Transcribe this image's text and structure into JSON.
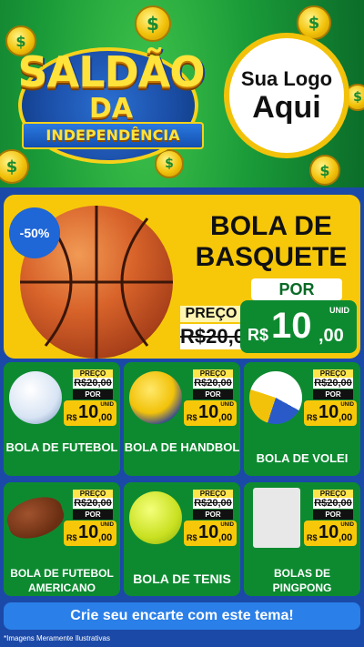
{
  "header": {
    "title_line1": "SALDÃO",
    "title_line2": "DA",
    "title_line3": "INDEPENDÊNCIA",
    "logo_line1": "Sua Logo",
    "logo_line2": "Aqui"
  },
  "colors": {
    "green": "#0d8a30",
    "yellow": "#f7c80a",
    "blue": "#1b49a8"
  },
  "feature": {
    "discount": "-50%",
    "name": "BOLA DE BASQUETE",
    "preco_label": "PREÇO",
    "old_price": "R$20,00",
    "por_label": "POR",
    "currency": "R$",
    "price_int": "10",
    "price_cents": ",00",
    "unit": "UNID"
  },
  "products": [
    {
      "name": "BOLA DE FUTEBOL",
      "preco": "PREÇO",
      "old": "R$20,00",
      "por": "POR",
      "rs": "R$",
      "val": "10",
      "cents": ",00",
      "unid": "UNID"
    },
    {
      "name": "BOLA DE HANDBOL",
      "preco": "PREÇO",
      "old": "R$20,00",
      "por": "POR",
      "rs": "R$",
      "val": "10",
      "cents": ",00",
      "unid": "UNID"
    },
    {
      "name": "BOLA DE VOLEI",
      "preco": "PREÇO",
      "old": "R$20,00",
      "por": "POR",
      "rs": "R$",
      "val": "10",
      "cents": ",00",
      "unid": "UNID"
    },
    {
      "name": "BOLA DE FUTEBOL AMERICANO",
      "preco": "PREÇO",
      "old": "R$20,00",
      "por": "POR",
      "rs": "R$",
      "val": "10",
      "cents": ",00",
      "unid": "UNID"
    },
    {
      "name": "BOLA DE TENIS",
      "preco": "PREÇO",
      "old": "R$20,00",
      "por": "POR",
      "rs": "R$",
      "val": "10",
      "cents": ",00",
      "unid": "UNID"
    },
    {
      "name": "BOLAS DE PINGPONG",
      "preco": "PREÇO",
      "old": "R$20,00",
      "por": "POR",
      "rs": "R$",
      "val": "10",
      "cents": ",00",
      "unid": "UNID"
    }
  ],
  "cta": "Crie seu encarte com este tema!",
  "footnote": "*Imagens Meramente Ilustrativas"
}
